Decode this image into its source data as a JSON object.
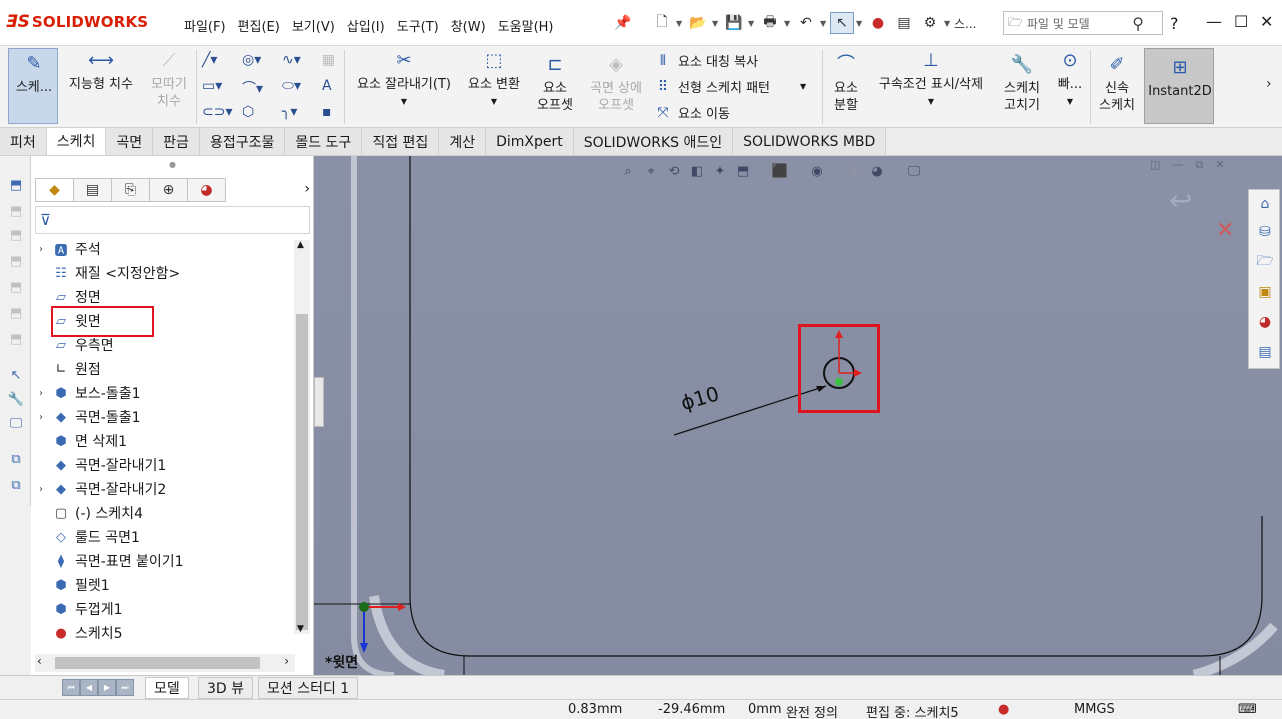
{
  "app": {
    "logo_ds": "ƎS",
    "logo_name": "SOLIDWORKS"
  },
  "menu": [
    "파일(F)",
    "편집(E)",
    "보기(V)",
    "삽입(I)",
    "도구(T)",
    "창(W)",
    "도움말(H)"
  ],
  "quick_access": {
    "truncated_label": "스..."
  },
  "search": {
    "placeholder": "파일 및 모델"
  },
  "help": "?",
  "ribbon": {
    "sketch": "스케...",
    "smart_dimension": "지능형 치수",
    "offset_on_surface_1": "모따기",
    "offset_on_surface_2": "치수",
    "trim": "요소 잘라내기(T)",
    "convert": "요소 변환",
    "offset_1": "요소",
    "offset_2": "오프셋",
    "surface_offset_1": "곡면 상에",
    "surface_offset_2": "오프셋",
    "mirror": "요소 대칭 복사",
    "linear_pattern": "선형 스케치 패턴",
    "move": "요소 이동",
    "split_1": "요소",
    "split_2": "분할",
    "relations": "구속조건 표시/삭제",
    "repair_1": "스케치",
    "repair_2": "고치기",
    "quick_snaps": "빠...",
    "rapid_1": "신속",
    "rapid_2": "스케치",
    "instant2d": "Instant2D"
  },
  "tabs": [
    "피처",
    "스케치",
    "곡면",
    "판금",
    "용접구조물",
    "몰드 도구",
    "직접 편집",
    "계산",
    "DimXpert",
    "SOLIDWORKS 애드인",
    "SOLIDWORKS MBD"
  ],
  "tree": [
    {
      "label": "주석",
      "expandable": true,
      "icon": "annotations-icon"
    },
    {
      "label": "재질 <지정안함>",
      "expandable": false,
      "icon": "material-icon"
    },
    {
      "label": "정면",
      "expandable": false,
      "icon": "plane-icon"
    },
    {
      "label": "윗면",
      "expandable": false,
      "icon": "plane-icon"
    },
    {
      "label": "우측면",
      "expandable": false,
      "icon": "plane-icon"
    },
    {
      "label": "원점",
      "expandable": false,
      "icon": "origin-icon"
    },
    {
      "label": "보스-돌출1",
      "expandable": true,
      "icon": "boss-extrude-icon"
    },
    {
      "label": "곡면-돌출1",
      "expandable": true,
      "icon": "surface-extrude-icon"
    },
    {
      "label": "면 삭제1",
      "expandable": false,
      "icon": "delete-face-icon"
    },
    {
      "label": "곡면-잘라내기1",
      "expandable": false,
      "icon": "surface-cut-icon"
    },
    {
      "label": "곡면-잘라내기2",
      "expandable": true,
      "icon": "surface-cut-icon"
    },
    {
      "label": "(-) 스케치4",
      "expandable": false,
      "icon": "sketch-icon"
    },
    {
      "label": "룰드 곡면1",
      "expandable": false,
      "icon": "ruled-surface-icon"
    },
    {
      "label": "곡면-표면 붙이기1",
      "expandable": false,
      "icon": "knit-surface-icon"
    },
    {
      "label": "필렛1",
      "expandable": false,
      "icon": "fillet-icon"
    },
    {
      "label": "두껍게1",
      "expandable": false,
      "icon": "thicken-icon"
    },
    {
      "label": "스케치5",
      "expandable": false,
      "icon": "sketch-edit-icon"
    }
  ],
  "graphics": {
    "dimension": "ϕ10",
    "view_label": "*윗면"
  },
  "bottom_tabs": [
    "모델",
    "3D 뷰",
    "모션 스터디 1"
  ],
  "status": {
    "x": "0.83mm",
    "y": "-29.46mm",
    "z": "0mm",
    "state": "완전 정의",
    "editing": "편집 중: 스케치5",
    "units": "MMGS"
  },
  "colors": {
    "accent": "#d81e05",
    "highlight": "#e0141e",
    "viewport": "#878ea4"
  }
}
